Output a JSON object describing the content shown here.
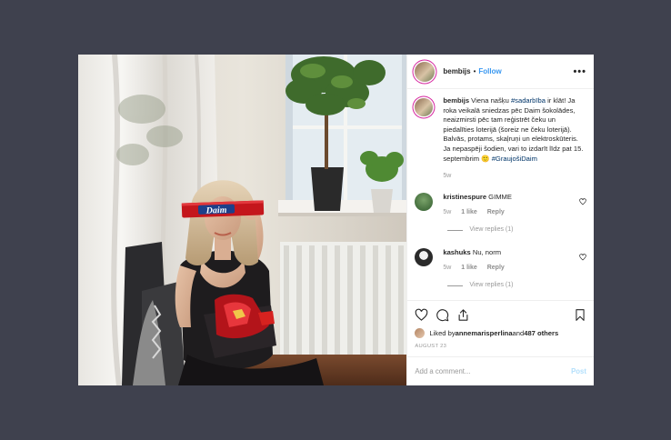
{
  "post": {
    "username": "bembijs",
    "separator": "•",
    "follow_label": "Follow",
    "more_icon": "more-icon",
    "more_label": "•••"
  },
  "caption": {
    "username": "bembijs",
    "text_1": " Viena našķu ",
    "tag_1": "#sadarbība",
    "text_2": " ir klāt! Ja roka veikalā sniedzas pēc Daim šokolādes, neaizmirsti pēc tam reģistrēt čeku un piedalīties loterijā (šoreiz ne čeku loterijā). Balvās, protams, skaļruņi un elektroskūteris. Ja nepaspēji šodien, vari to izdarīt līdz pat 15. septembrim 🙂 ",
    "tag_2": "#GraujošiDaim",
    "age": "5w"
  },
  "comments": [
    {
      "username": "kristinespure",
      "text": " GIMME",
      "age": "5w",
      "likes": "1 like",
      "reply": "Reply",
      "view_replies": "View replies (1)",
      "avatar_color": "#3f6d3a"
    },
    {
      "username": "kashuks",
      "text": " Nu, norm",
      "age": "5w",
      "likes": "1 like",
      "reply": "Reply",
      "view_replies": "View replies (1)",
      "avatar_color": "#3a3a3a"
    }
  ],
  "likes": {
    "prefix": "Liked by ",
    "user": "annemarisperlina",
    "and": " and ",
    "count": "487 others"
  },
  "date": "AUGUST 23",
  "add_comment": {
    "placeholder": "Add a comment...",
    "post_label": "Post"
  },
  "photo": {
    "bar_text": "Daim"
  },
  "colors": {
    "background": "#3f414e",
    "follow": "#3897f0",
    "hashtag": "#003569",
    "post_disabled": "#b2dffc",
    "story_ring": "#d6249f"
  }
}
